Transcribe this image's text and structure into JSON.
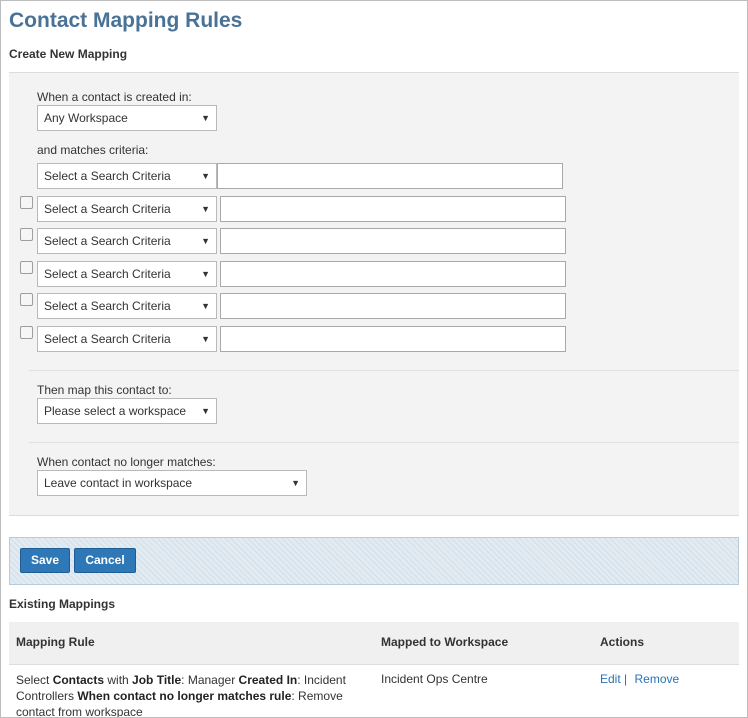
{
  "page": {
    "title": "Contact Mapping Rules"
  },
  "create": {
    "heading": "Create New Mapping",
    "created_in_label": "When a contact is created in:",
    "created_in_value": "Any Workspace",
    "criteria_label": "and matches criteria:",
    "criteria_rows": [
      {
        "placeholder": "Select a Search Criteria",
        "has_checkbox": false
      },
      {
        "placeholder": "Select a Search Criteria",
        "has_checkbox": true
      },
      {
        "placeholder": "Select a Search Criteria",
        "has_checkbox": true
      },
      {
        "placeholder": "Select a Search Criteria",
        "has_checkbox": true
      },
      {
        "placeholder": "Select a Search Criteria",
        "has_checkbox": true
      },
      {
        "placeholder": "Select a Search Criteria",
        "has_checkbox": true
      }
    ],
    "map_to_label": "Then map this contact to:",
    "map_to_value": "Please select a workspace",
    "no_longer_label": "When contact no longer matches:",
    "no_longer_value": "Leave contact in workspace"
  },
  "buttons": {
    "save": "Save",
    "cancel": "Cancel"
  },
  "existing": {
    "heading": "Existing Mappings",
    "columns": [
      "Mapping Rule",
      "Mapped to Workspace",
      "Actions"
    ],
    "rows": [
      {
        "rule": {
          "t1": "Select ",
          "b1": "Contacts",
          "t2": " with ",
          "b2": "Job Title",
          "t3": ": Manager ",
          "b3": "Created In",
          "t4": ": Incident Controllers ",
          "b4": "When contact no longer matches rule",
          "t5": ": Remove contact from workspace"
        },
        "workspace": "Incident Ops Centre",
        "edit": "Edit",
        "separator": "|",
        "remove": "Remove"
      }
    ]
  },
  "colors": {
    "title": "#4a7296",
    "button": "#2e78b8",
    "link": "#2a72b5",
    "panel": "#f3f3f3"
  },
  "icons": {
    "dropdown": "triangle-down-icon"
  }
}
